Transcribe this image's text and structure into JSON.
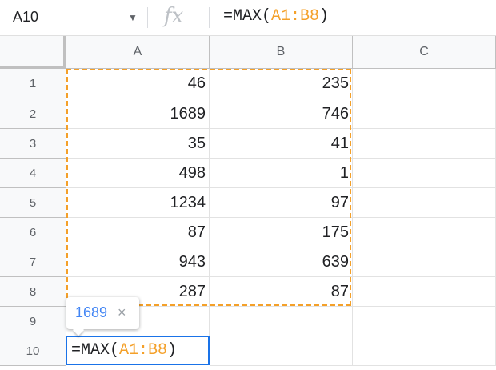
{
  "formula_bar": {
    "name_box": "A10",
    "fx_label": "fx",
    "formula": {
      "prefix": "=MAX(",
      "range": "A1:B8",
      "suffix": ")"
    }
  },
  "grid": {
    "columns": [
      "A",
      "B",
      "C"
    ],
    "rows": [
      "1",
      "2",
      "3",
      "4",
      "5",
      "6",
      "7",
      "8",
      "9",
      "10"
    ],
    "data": [
      [
        "46",
        "235"
      ],
      [
        "1689",
        "746"
      ],
      [
        "35",
        "41"
      ],
      [
        "498",
        "1"
      ],
      [
        "1234",
        "97"
      ],
      [
        "87",
        "175"
      ],
      [
        "943",
        "639"
      ],
      [
        "287",
        "87"
      ]
    ]
  },
  "active_cell": {
    "prefix": "=MAX(",
    "range": "A1:B8",
    "suffix": ")"
  },
  "tooltip": {
    "value": "1689",
    "close": "×"
  },
  "colors": {
    "range_highlight": "#f4a029",
    "selection": "#1a73e8",
    "tooltip_value": "#4285f4"
  }
}
